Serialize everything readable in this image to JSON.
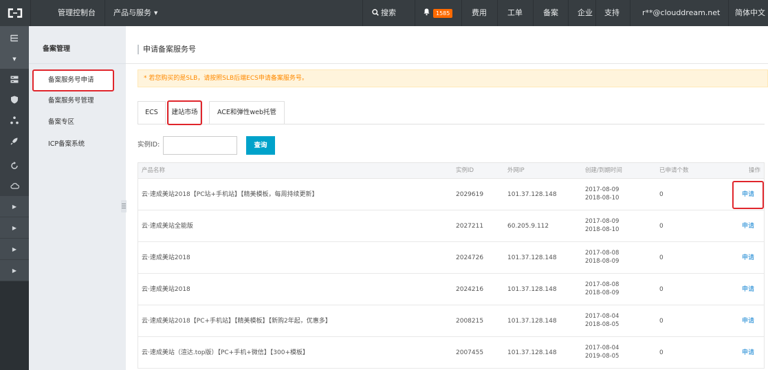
{
  "colors": {
    "topbar_bg": "#373d41",
    "sidebar_bg": "#2b3034",
    "subnav_bg": "#eaedf1",
    "accent_blue": "#00a2ca",
    "link_blue": "#0a7fd0",
    "badge_orange": "#ff6a00",
    "notice_bg": "#fff4dc",
    "notice_text": "#ff8a00",
    "highlight_red": "#e0252b"
  },
  "topbar": {
    "logo_icon": "aliyun-logo-icon",
    "console": "管理控制台",
    "products": "产品与服务",
    "products_icon": "caret-down-icon",
    "search_icon": "search-icon",
    "search": "搜索",
    "bell_icon": "bell-icon",
    "notification_count": "1585",
    "nav": [
      "费用",
      "工单",
      "备案",
      "企业",
      "支持"
    ],
    "account": "r**@clouddream.net",
    "language": "简体中文"
  },
  "icon_sidebar": {
    "toggle_icon": "menu-icon",
    "collapse_icon": "caret-down-icon",
    "icons": [
      "server-list-icon",
      "shield-icon",
      "network-nodes-icon",
      "rocket-icon",
      "refresh-icon",
      "cloud-icon"
    ],
    "expanders": [
      "caret-right-icon",
      "caret-right-icon",
      "caret-right-icon",
      "caret-right-icon"
    ]
  },
  "subnav": {
    "title": "备案管理",
    "items": [
      {
        "label": "备案服务号申请",
        "active": true
      },
      {
        "label": "备案服务号管理"
      },
      {
        "label": "备案专区"
      },
      {
        "label": "ICP备案系统"
      }
    ],
    "collapse_icon": "collapse-handle-icon"
  },
  "main": {
    "title": "申请备案服务号",
    "notice": "* 若您购买的是SLB，请按照SLB后端ECS申请备案服务号。",
    "tabs": [
      {
        "label": "ECS"
      },
      {
        "label": "建站市场",
        "active": true
      },
      {
        "label": "ACE和弹性web托管"
      }
    ],
    "search": {
      "label": "实例ID:",
      "value": "",
      "button": "查询"
    },
    "table": {
      "columns": [
        "产品名称",
        "实例ID",
        "外网IP",
        "创建/到期时间",
        "已申请个数",
        "操作"
      ],
      "rows": [
        {
          "name": "云·速成美站2018【PC站+手机站】【精美模板，每周持续更新】",
          "instance_id": "2029619",
          "ip": "101.37.128.148",
          "created": "2017-08-09",
          "expires": "2018-08-10",
          "applied": "0",
          "action": "申请"
        },
        {
          "name": "云·速成美站全能版",
          "instance_id": "2027211",
          "ip": "60.205.9.112",
          "created": "2017-08-09",
          "expires": "2018-08-10",
          "applied": "0",
          "action": "申请"
        },
        {
          "name": "云·速成美站2018",
          "instance_id": "2024726",
          "ip": "101.37.128.148",
          "created": "2017-08-08",
          "expires": "2018-08-09",
          "applied": "0",
          "action": "申请"
        },
        {
          "name": "云·速成美站2018",
          "instance_id": "2024216",
          "ip": "101.37.128.148",
          "created": "2017-08-08",
          "expires": "2018-08-09",
          "applied": "0",
          "action": "申请"
        },
        {
          "name": "云·速成美站2018【PC+手机站】【精美模板】【新购2年起，优惠多】",
          "instance_id": "2008215",
          "ip": "101.37.128.148",
          "created": "2017-08-04",
          "expires": "2018-08-05",
          "applied": "0",
          "action": "申请"
        },
        {
          "name": "云·速成美站（渲达.top版）【PC+手机+微信】【300+模板】",
          "instance_id": "2007455",
          "ip": "101.37.128.148",
          "created": "2017-08-04",
          "expires": "2019-08-05",
          "applied": "0",
          "action": "申请"
        }
      ]
    }
  }
}
